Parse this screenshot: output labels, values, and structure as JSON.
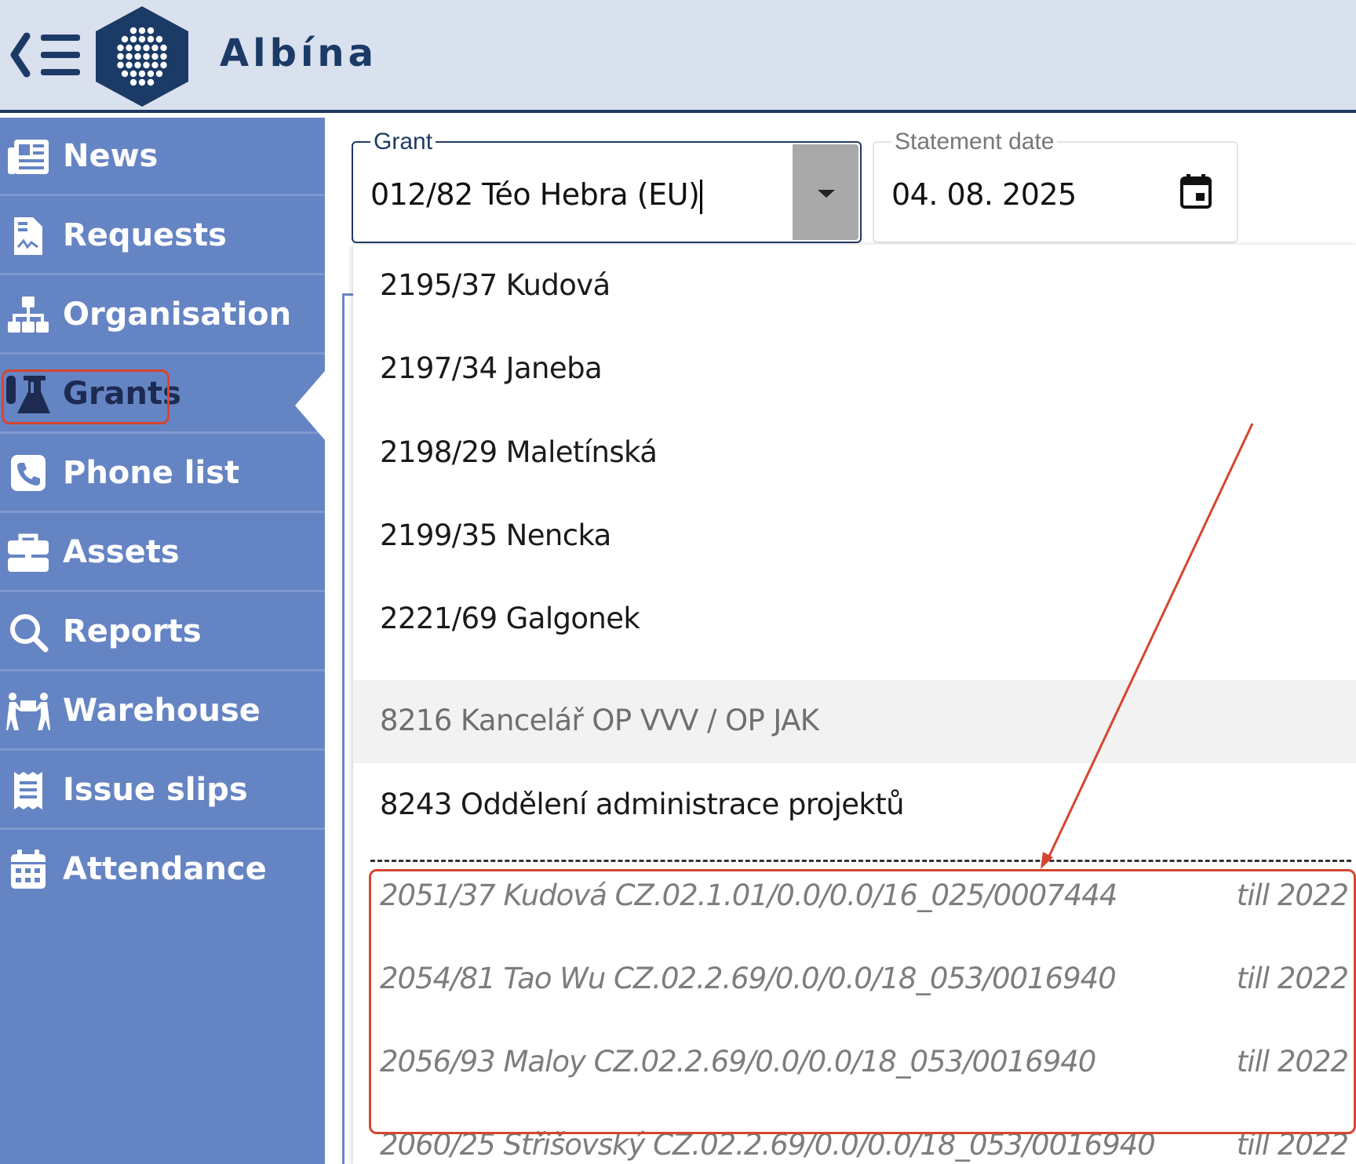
{
  "app": {
    "title": "Albína"
  },
  "sidebar": {
    "items": [
      {
        "label": "News",
        "icon": "newspaper-icon"
      },
      {
        "label": "Requests",
        "icon": "document-signature-icon"
      },
      {
        "label": "Organisation",
        "icon": "sitemap-icon"
      },
      {
        "label": "Grants",
        "icon": "flask-icon",
        "active": true
      },
      {
        "label": "Phone list",
        "icon": "phone-icon"
      },
      {
        "label": "Assets",
        "icon": "briefcase-icon"
      },
      {
        "label": "Reports",
        "icon": "search-icon"
      },
      {
        "label": "Warehouse",
        "icon": "people-carry-icon"
      },
      {
        "label": "Issue slips",
        "icon": "receipt-icon"
      },
      {
        "label": "Attendance",
        "icon": "calendar-icon"
      }
    ]
  },
  "form": {
    "grant": {
      "label": "Grant",
      "value": "012/82 Téo Hebra (EU)"
    },
    "statement_date": {
      "label": "Statement date",
      "value": "04. 08. 2025"
    }
  },
  "dropdown": {
    "options": [
      {
        "label": "2195/37 Kudová"
      },
      {
        "label": "2197/34 Janeba"
      },
      {
        "label": "2198/29 Maletínská"
      },
      {
        "label": "2199/35 Nencka"
      },
      {
        "label": "2221/69 Galgonek"
      },
      {
        "label": "8216 Kancelář OP VVV / OP JAK",
        "disabled": true
      },
      {
        "label": "8243 Oddělení administrace projektů"
      }
    ],
    "expired_options": [
      {
        "label": "2051/37 Kudová CZ.02.1.01/0.0/0.0/16_025/0007444",
        "till": "till 2022"
      },
      {
        "label": "2054/81 Tao Wu CZ.02.2.69/0.0/0.0/18_053/0016940",
        "till": "till 2022"
      },
      {
        "label": "2056/93 Maloy CZ.02.2.69/0.0/0.0/18_053/0016940",
        "till": "till 2022"
      },
      {
        "label": "2060/25 Střišovský CZ.02.2.69/0.0/0.0/18_053/0016940",
        "till": "till 2022"
      }
    ]
  },
  "colors": {
    "header_bg": "#d9e0ee",
    "sidebar_bg": "#6584c3",
    "brand_dark": "#1b3a66",
    "annotation": "#d6452e"
  }
}
